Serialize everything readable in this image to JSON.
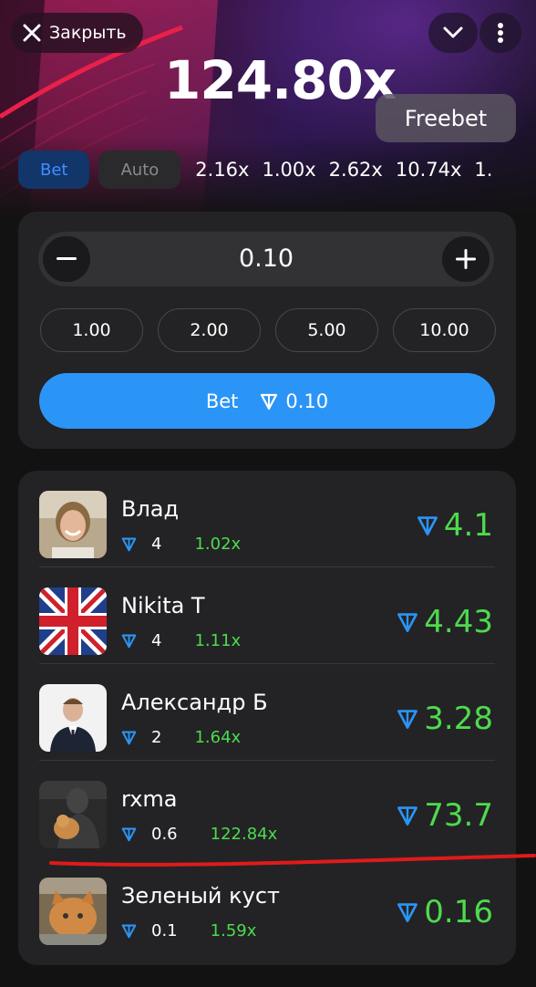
{
  "header": {
    "close_label": "Закрыть",
    "multiplier": "124.80x",
    "freebet_label": "Freebet"
  },
  "tabs": [
    {
      "label": "Bet",
      "active": true
    },
    {
      "label": "Auto",
      "active": false
    }
  ],
  "history": [
    "2.16x",
    "1.00x",
    "2.62x",
    "10.74x",
    "1."
  ],
  "bet_panel": {
    "amount": "0.10",
    "chips": [
      "1.00",
      "2.00",
      "5.00",
      "10.00"
    ],
    "bet_label": "Bet",
    "bet_amount": "0.10"
  },
  "players": [
    {
      "name": "Влад",
      "bet": "4",
      "multiplier": "1.02x",
      "win": "4.1"
    },
    {
      "name": "Nikita T",
      "bet": "4",
      "multiplier": "1.11x",
      "win": "4.43"
    },
    {
      "name": "Александр Б",
      "bet": "2",
      "multiplier": "1.64x",
      "win": "3.28"
    },
    {
      "name": "rxma",
      "bet": "0.6",
      "multiplier": "122.84x",
      "win": "73.7"
    },
    {
      "name": "Зеленый куст",
      "bet": "0.1",
      "multiplier": "1.59x",
      "win": "0.16"
    }
  ],
  "colors": {
    "accent_blue": "#2b95f7",
    "win_green": "#4ddb4d",
    "panel": "#232325",
    "annotation_red": "#e01a1a"
  },
  "icons": {
    "close": "close-icon",
    "chevron": "chevron-down-icon",
    "menu": "more-vertical-icon",
    "currency": "ton-icon"
  }
}
